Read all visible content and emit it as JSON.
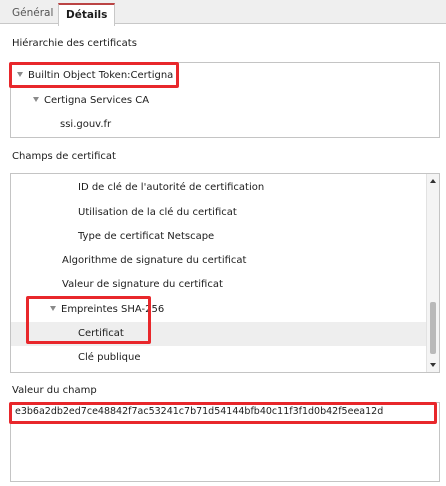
{
  "tabs": [
    {
      "label": "Général",
      "active": false
    },
    {
      "label": "Détails",
      "active": true
    }
  ],
  "hierarchy": {
    "label": "Hiérarchie des certificats",
    "items": [
      {
        "label": "Builtin Object Token:Certigna",
        "expanded": true
      },
      {
        "label": "Certigna Services CA",
        "expanded": true
      },
      {
        "label": "ssi.gouv.fr"
      }
    ]
  },
  "fields": {
    "label": "Champs de certificat",
    "items": [
      {
        "label": "ID de clé de l'autorité de certification"
      },
      {
        "label": "Utilisation de la clé du certificat"
      },
      {
        "label": "Type de certificat Netscape"
      },
      {
        "label": "Algorithme de signature du certificat"
      },
      {
        "label": "Valeur de signature du certificat"
      },
      {
        "label": "Empreintes SHA-256",
        "expanded": true
      },
      {
        "label": "Certificat",
        "selected": true
      },
      {
        "label": "Clé publique"
      }
    ]
  },
  "value": {
    "label": "Valeur du champ",
    "text": "e3b6a2db2ed7ce48842f7ac53241c7b71d54144bfb40c11f3f1d0b42f5eea12d"
  },
  "colors": {
    "highlight": "#e8272b",
    "selected_row": "#eeeeee"
  }
}
